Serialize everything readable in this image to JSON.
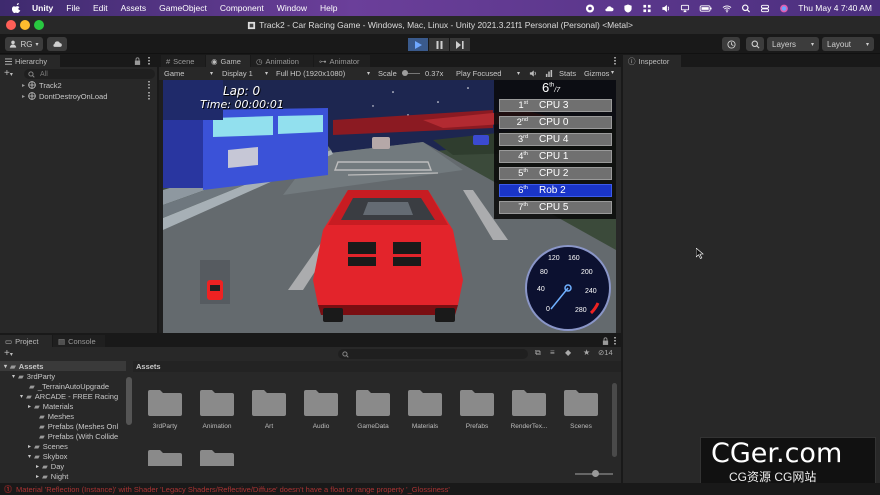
{
  "macmenu": {
    "app": "Unity",
    "items": [
      "File",
      "Edit",
      "Assets",
      "GameObject",
      "Component",
      "Window",
      "Help"
    ],
    "clock": "Thu May 4  7:40 AM"
  },
  "window": {
    "title": "Track2 - Car Racing Game - Windows, Mac, Linux - Unity 2021.3.21f1 Personal (Personal) <Metal>"
  },
  "toolbar": {
    "account": "RG",
    "layers": "Layers",
    "layout": "Layout"
  },
  "hierarchy": {
    "tab": "Hierarchy",
    "search_placeholder": "All",
    "items": [
      "Track2",
      "DontDestroyOnLoad"
    ]
  },
  "center_tabs": [
    "Scene",
    "Game",
    "Animation",
    "Animator"
  ],
  "game_toolbar": {
    "display_mode": "Game",
    "display": "Display 1",
    "resolution": "Full HD (1920x1080)",
    "scale_label": "Scale",
    "scale_value": "0.37x",
    "play_mode": "Play Focused",
    "stats": "Stats",
    "gizmos": "Gizmos"
  },
  "hud": {
    "lap": "Lap: 0",
    "time": "Time: 00:00:01",
    "position_place": "6",
    "position_suffix": "th",
    "position_total": "/7",
    "leaderboard": [
      {
        "pos": "1",
        "suf": "st",
        "name": "CPU 3",
        "highlight": false
      },
      {
        "pos": "2",
        "suf": "nd",
        "name": "CPU 0",
        "highlight": false
      },
      {
        "pos": "3",
        "suf": "rd",
        "name": "CPU 4",
        "highlight": false
      },
      {
        "pos": "4",
        "suf": "th",
        "name": "CPU 1",
        "highlight": false
      },
      {
        "pos": "5",
        "suf": "th",
        "name": "CPU 2",
        "highlight": false
      },
      {
        "pos": "6",
        "suf": "th",
        "name": "Rob 2",
        "highlight": true
      },
      {
        "pos": "7",
        "suf": "th",
        "name": "CPU 5",
        "highlight": false
      }
    ],
    "speedometer_ticks": [
      "0",
      "40",
      "80",
      "120",
      "160",
      "200",
      "240",
      "280"
    ]
  },
  "inspector": {
    "tab": "Inspector"
  },
  "project": {
    "tabs": [
      "Project",
      "Console"
    ],
    "count": "14",
    "tree_root": "Assets",
    "tree": [
      "3rdParty",
      "_TerrainAutoUpgrade",
      "ARCADE - FREE Racing",
      "Materials",
      "Meshes",
      "Prefabs (Meshes Onl",
      "Prefabs (With Collide",
      "Scenes",
      "Skybox",
      "Day",
      "Night"
    ],
    "breadcrumb": "Assets",
    "folders": [
      "3rdParty",
      "Animation",
      "Art",
      "Audio",
      "GameData",
      "Materials",
      "Prefabs",
      "RenderTex...",
      "Scenes"
    ]
  },
  "status": {
    "message": "Material 'Reflection (Instance)' with Shader 'Legacy Shaders/Reflective/Diffuse' doesn't have a float or range property '_Glossiness'"
  },
  "watermark": {
    "domain": "CGer.com",
    "sub": "CG资源  CG网站"
  }
}
